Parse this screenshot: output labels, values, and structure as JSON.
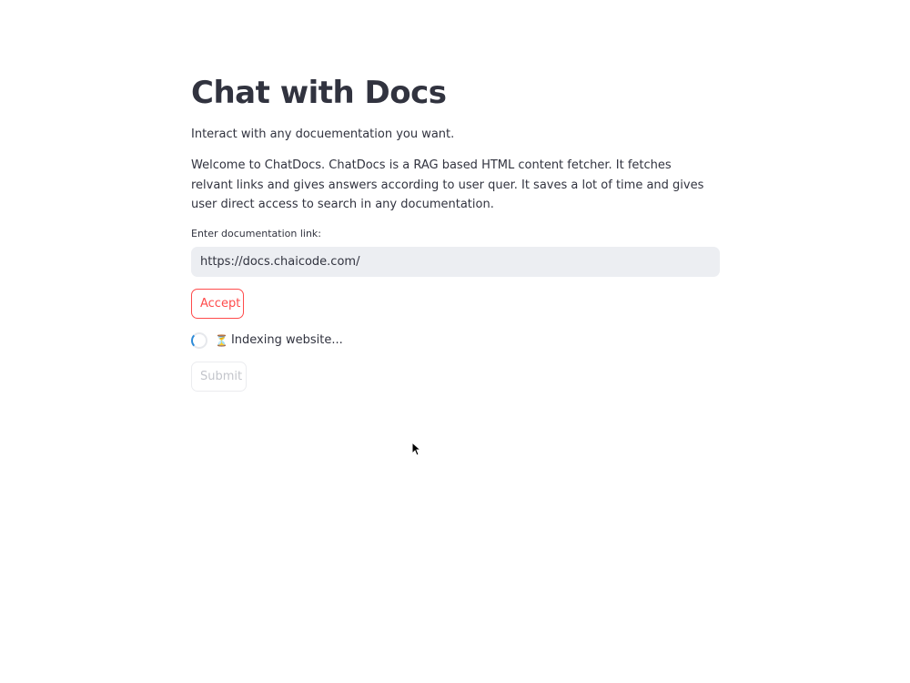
{
  "page": {
    "title": "Chat with Docs",
    "subtitle": "Interact with any docuementation you want.",
    "description": "Welcome to ChatDocs. ChatDocs is a RAG based HTML content fetcher. It fetches relvant links and gives answers according to user quer. It saves a lot of time and gives user direct access to search in any documentation."
  },
  "form": {
    "link_label": "Enter documentation link:",
    "link_value": "https://docs.chaicode.com/",
    "accept_label": "Accept",
    "status_icon": "⏳",
    "status_text": "Indexing website...",
    "submit_label": "Submit"
  },
  "colors": {
    "accent": "#ff4b4b",
    "text": "#31333f",
    "input_bg": "#eceef2",
    "spinner": "#2e8bd8"
  },
  "icons": {
    "spinner": "spinner-icon",
    "status": "hourglass-icon",
    "cursor": "mouse-pointer-icon"
  }
}
